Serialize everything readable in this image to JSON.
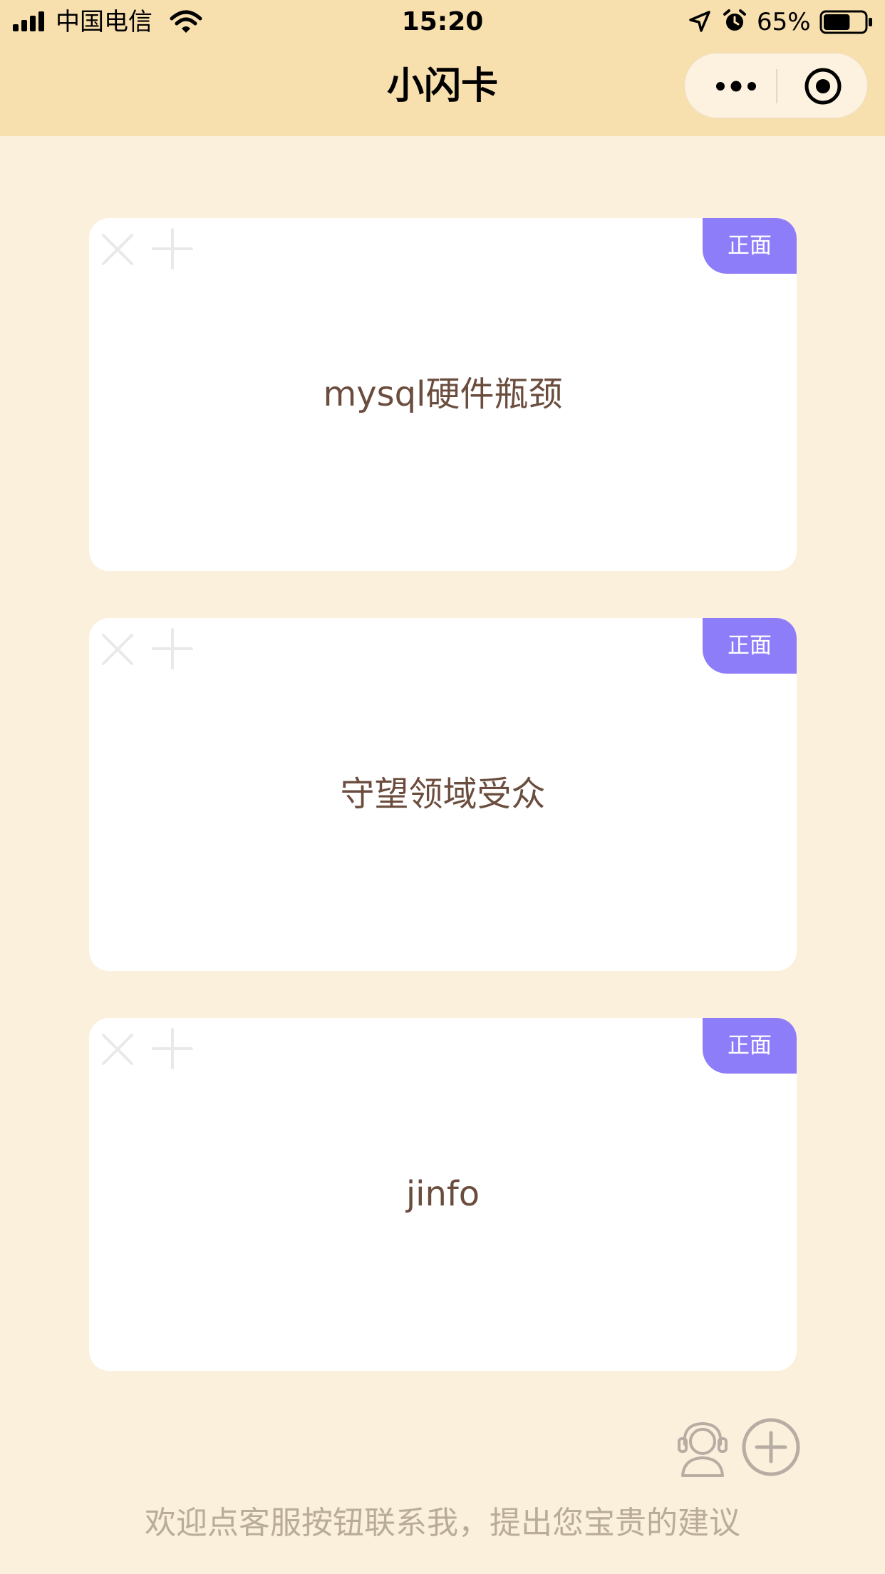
{
  "status_bar": {
    "carrier": "中国电信",
    "time": "15:20",
    "battery_percent": "65%",
    "battery_level": 0.65
  },
  "nav": {
    "title": "小闪卡"
  },
  "cards": [
    {
      "badge": "正面",
      "text": "mysql硬件瓶颈"
    },
    {
      "badge": "正面",
      "text": "守望领域受众"
    },
    {
      "badge": "正面",
      "text": "jinfo"
    }
  ],
  "footer": {
    "tip": "欢迎点客服按钮联系我，提出您宝贵的建议"
  },
  "colors": {
    "page_bg": "#FBF0DC",
    "header_bg": "#F8DFAE",
    "badge_bg": "#8E7DF8",
    "card_text": "#6B4D3E",
    "tip_text": "#B9AC99"
  }
}
